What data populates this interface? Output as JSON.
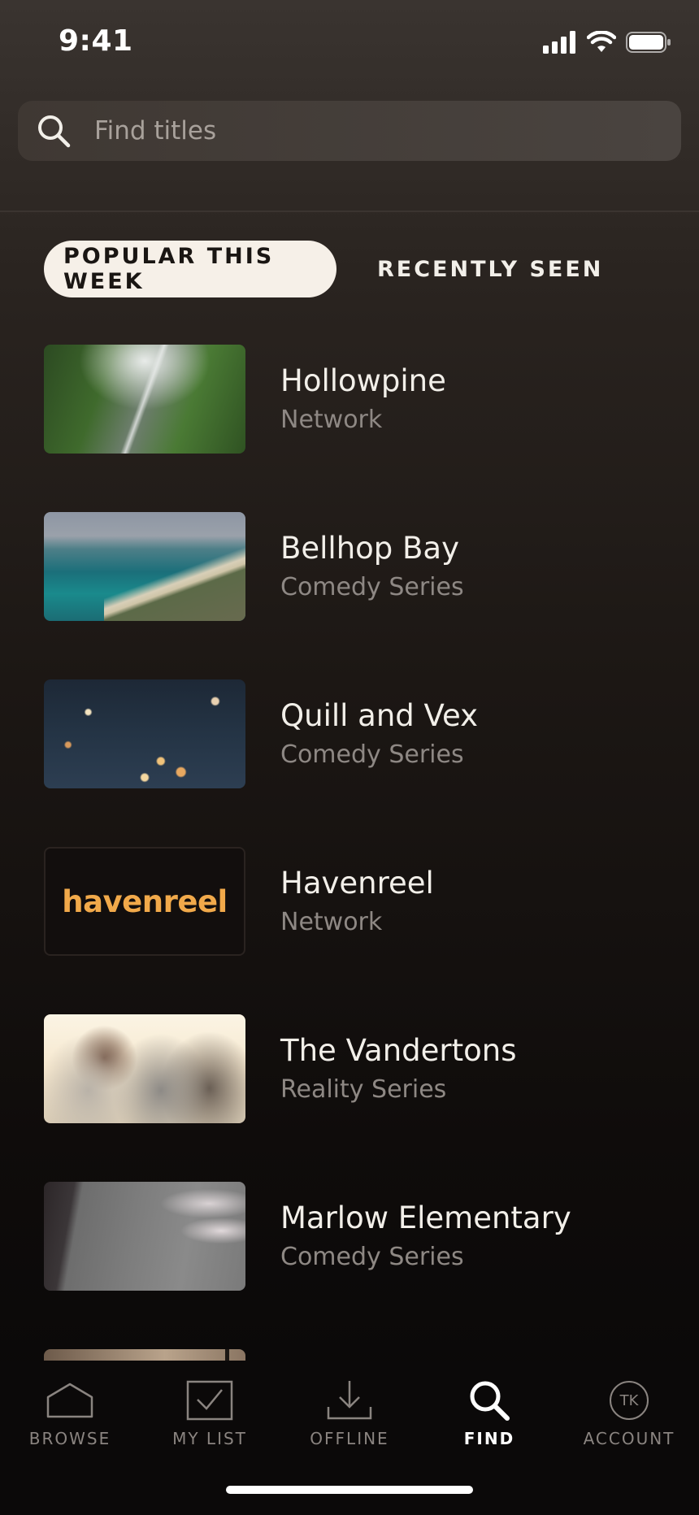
{
  "status_bar": {
    "time": "9:41",
    "icons": [
      "signal-icon",
      "wifi-icon",
      "battery-icon"
    ]
  },
  "search": {
    "placeholder": "Find titles",
    "value": "",
    "icon": "search-icon"
  },
  "tabs": [
    {
      "label": "POPULAR THIS WEEK",
      "active": true
    },
    {
      "label": "RECENTLY SEEN",
      "active": false
    }
  ],
  "results": [
    {
      "title": "Hollowpine",
      "subtitle": "Network"
    },
    {
      "title": "Bellhop Bay",
      "subtitle": "Comedy Series"
    },
    {
      "title": "Quill and Vex",
      "subtitle": "Comedy Series"
    },
    {
      "title": "Havenreel",
      "subtitle": "Network",
      "logo_text": "havenreel"
    },
    {
      "title": "The Vandertons",
      "subtitle": "Reality Series"
    },
    {
      "title": "Marlow Elementary",
      "subtitle": "Comedy Series"
    }
  ],
  "bottom_nav": [
    {
      "label": "BROWSE",
      "icon": "home-icon",
      "active": false
    },
    {
      "label": "MY LIST",
      "icon": "checkbox-icon",
      "active": false
    },
    {
      "label": "OFFLINE",
      "icon": "download-icon",
      "active": false
    },
    {
      "label": "FIND",
      "icon": "search-icon",
      "active": true
    },
    {
      "label": "ACCOUNT",
      "icon": "avatar-icon",
      "active": false,
      "initials": "TK"
    }
  ],
  "colors": {
    "accent_logo": "#f1a94a",
    "active_tab_bg": "#f6f0e8",
    "background": "#1c1714"
  }
}
